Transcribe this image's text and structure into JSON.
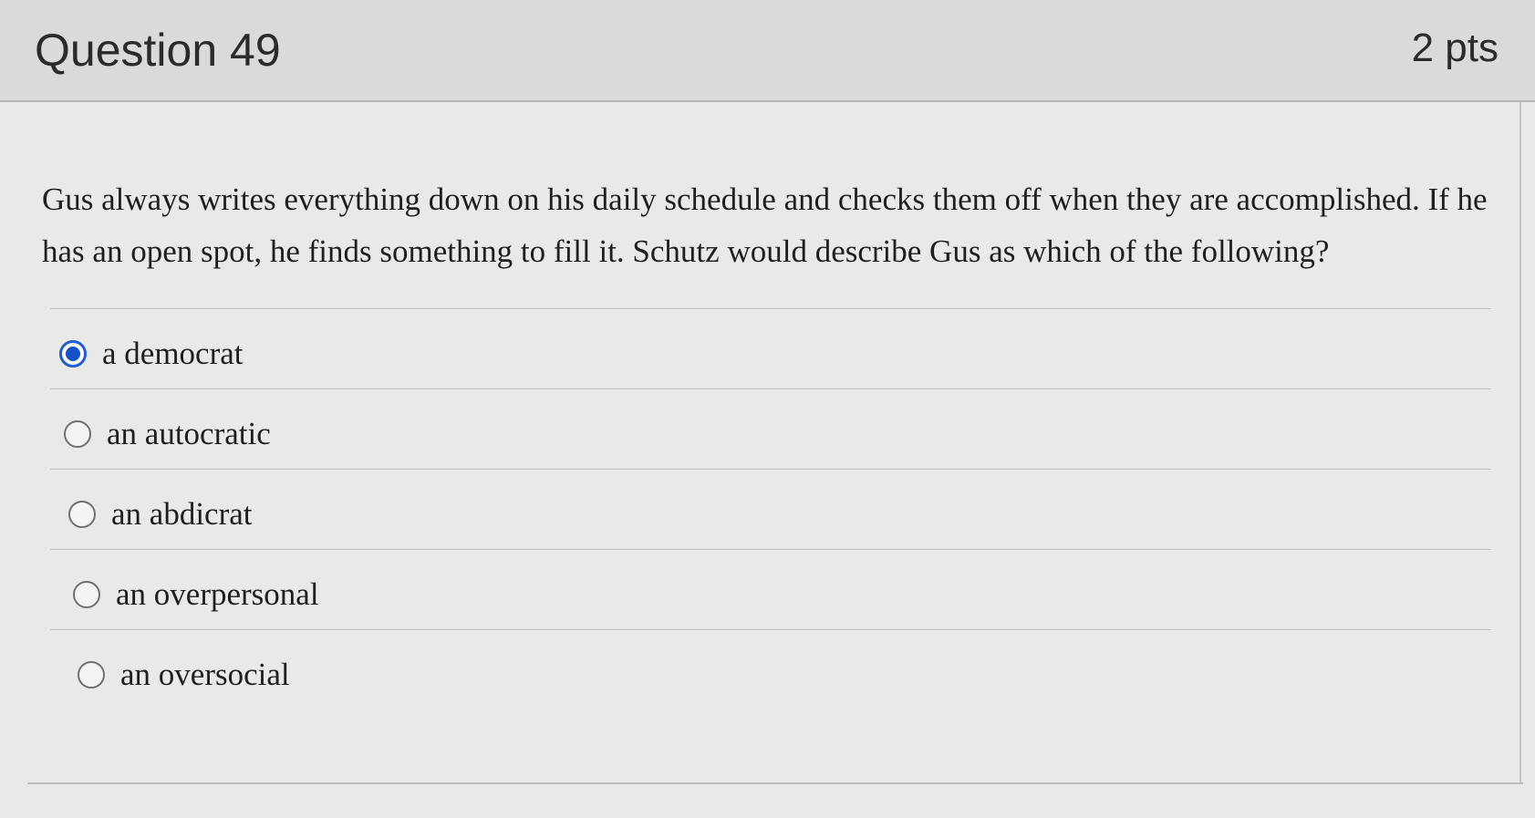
{
  "question": {
    "title": "Question 49",
    "points": "2 pts",
    "text": "Gus always writes everything down on his daily schedule and checks them off when they are accomplished. If he has an open spot, he finds something to fill it. Schutz would describe Gus as which of the following?"
  },
  "answers": [
    {
      "label": "a democrat",
      "selected": true
    },
    {
      "label": "an autocratic",
      "selected": false
    },
    {
      "label": "an abdicrat",
      "selected": false
    },
    {
      "label": "an overpersonal",
      "selected": false
    },
    {
      "label": "an oversocial",
      "selected": false
    }
  ],
  "colors": {
    "accent": "#1451c9",
    "text": "#1f1f1f",
    "header_bg": "#dadad8",
    "body_bg": "#e9e9e7"
  }
}
